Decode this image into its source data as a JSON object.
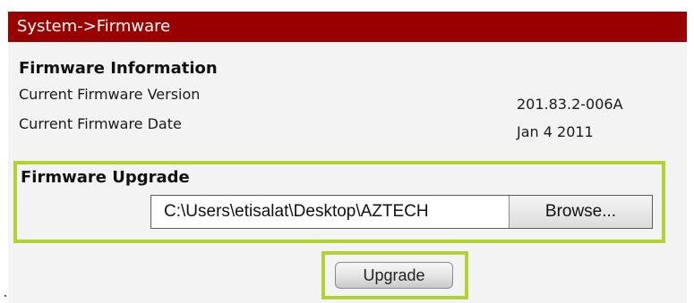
{
  "header": {
    "title": "System->Firmware"
  },
  "firmware_info": {
    "section_title": "Firmware Information",
    "rows": [
      {
        "label": "Current Firmware Version",
        "value": "201.83.2-006A"
      },
      {
        "label": "Current Firmware Date",
        "value": "Jan 4 2011"
      }
    ]
  },
  "firmware_upgrade": {
    "section_title": "Firmware Upgrade",
    "file_path": "C:\\Users\\etisalat\\Desktop\\AZTECH",
    "browse_label": "Browse...",
    "upgrade_label": "Upgrade"
  },
  "colors": {
    "header_bg": "#990000",
    "highlight": "#b2d234",
    "content_bg": "#f3f3f3"
  }
}
